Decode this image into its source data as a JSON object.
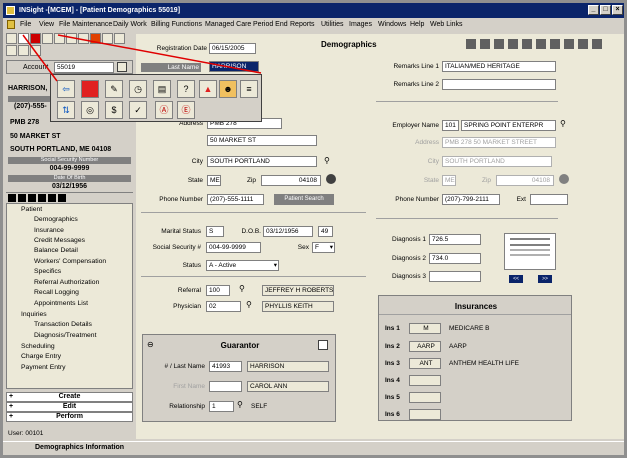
{
  "window": {
    "title": "INSight -[MCEM] - [Patient Demographics 55019]"
  },
  "menu": [
    "File",
    "View",
    "File Maintenance",
    "Daily Work",
    "Billing Functions",
    "Managed Care",
    "Period End",
    "Reports",
    "Utilities",
    "Images",
    "Windows",
    "Help",
    "Web Links"
  ],
  "left": {
    "account_label": "Account",
    "account_value": "55019",
    "patient_name": "HARRISON,",
    "home_phone": "(207)-555-",
    "address1": "PMB 278",
    "address2": "50 MARKET ST",
    "address3": "SOUTH PORTLAND, ME 04108",
    "ssn_label": "Social Security Number",
    "ssn_value": "004-99-9999",
    "dob_label": "Date Of Birth",
    "dob_value": "03/12/1956",
    "tree": {
      "patient": "Patient",
      "demographics": "Demographics",
      "insurance": "Insurance",
      "credit_messages": "Credit Messages",
      "balance_detail": "Balance Detail",
      "workers_comp": "Workers' Compensation",
      "specifics": "Specifics",
      "referral_auth": "Referral Authorization",
      "recall_logging": "Recall Logging",
      "appointments_list": "Appointments List",
      "inquiries": "Inquiries",
      "transaction_details": "Transaction Details",
      "diagnosis_treatment": "Diagnosis/Treatment",
      "scheduling": "Scheduling",
      "charge_entry": "Charge Entry",
      "payment_entry": "Payment Entry"
    },
    "create": "Create",
    "edit": "Edit",
    "perform": "Perform",
    "user": "User: 00101"
  },
  "status": {
    "text": "Demographics Information"
  },
  "form": {
    "title": "Demographics",
    "registration_date_label": "Registration Date",
    "registration_date": "06/15/2005",
    "last_name_label": "Last Name",
    "last_name": "HARRISON",
    "address_label": "Address",
    "address1": "PMB 278",
    "address2": "50 MARKET ST",
    "city_label": "City",
    "city": "SOUTH PORTLAND",
    "state_label": "State",
    "state": "ME",
    "zip_label": "Zip",
    "zip": "04108",
    "phone_label": "Phone Number",
    "phone": "(207)-555-1111",
    "patient_search": "Patient Search",
    "marital_label": "Marital Status",
    "marital": "S",
    "dob_label": "D.O.B.",
    "dob": "03/12/1956",
    "age": "49",
    "ssn_label": "Social Security #",
    "ssn": "004-99-9999",
    "sex_label": "Sex",
    "sex": "F",
    "status_label": "Status",
    "status_value": "A - Active",
    "referral_label": "Referral",
    "referral_code": "100",
    "referral_name": "JEFFREY H ROBERTS",
    "physician_label": "Physician",
    "physician_code": "02",
    "physician_name": "PHYLLIS KEITH",
    "remarks1_label": "Remarks Line 1",
    "remarks1": "ITALIAN/MED HERITAGE",
    "remarks2_label": "Remarks Line 2",
    "employer_label": "Employer Name",
    "employer_code": "101",
    "employer_name": "SPRING POINT ENTERPR",
    "emp_address_label": "Address",
    "emp_address": "PMB 278 50 MARKET STREET",
    "emp_city_label": "City",
    "emp_city": "SOUTH PORTLAND",
    "emp_state_label": "State",
    "emp_state": "ME",
    "emp_zip_label": "Zip",
    "emp_zip": "04108",
    "emp_phone_label": "Phone Number",
    "emp_phone": "(207)-799-2111",
    "ext_label": "Ext",
    "diag1_label": "Diagnosis 1",
    "diag1": "726.5",
    "diag2_label": "Diagnosis 2",
    "diag2": "734.0",
    "diag3_label": "Diagnosis 3",
    "nav_prev": "<<",
    "nav_next": ">>"
  },
  "guarantor": {
    "title": "Guarantor",
    "last_name_label": "# / Last Name",
    "number": "41993",
    "last_name": "HARRISON",
    "first_name_label": "First Name",
    "first_name": "CAROL ANN",
    "relationship_label": "Relationship",
    "relationship_code": "1",
    "relationship": "SELF"
  },
  "insurances": {
    "title": "Insurances",
    "rows": [
      {
        "label": "Ins 1",
        "code": "M",
        "name": "MEDICARE B"
      },
      {
        "label": "Ins 2",
        "code": "AARP",
        "name": "AARP"
      },
      {
        "label": "Ins 3",
        "code": "ANT",
        "name": "ANTHEM HEALTH LIFE"
      },
      {
        "label": "Ins 4",
        "code": "",
        "name": ""
      },
      {
        "label": "Ins 5",
        "code": "",
        "name": ""
      },
      {
        "label": "Ins 6",
        "code": "",
        "name": ""
      }
    ]
  },
  "colors": {
    "titlebar": "#0a246a",
    "panel": "#d4d0c8",
    "form_bg": "#ece9d8",
    "arrow": "#e00000"
  }
}
